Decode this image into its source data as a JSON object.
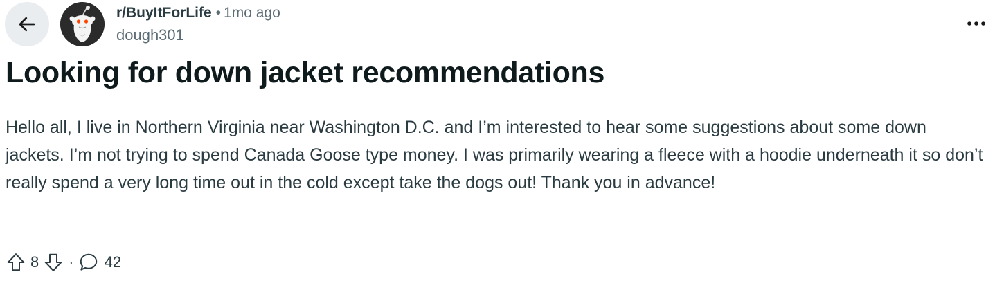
{
  "header": {
    "back_icon": "arrow-left-icon",
    "subreddit": "r/BuyItForLife",
    "separator": "•",
    "time_ago": "1mo ago",
    "username": "dough301",
    "more_icon": "more-horizontal-icon"
  },
  "post": {
    "title": "Looking for down jacket recommendations",
    "body": "Hello all, I live in Northern Virginia near Washington D.C. and I’m interested to hear some suggestions about some down jackets. I’m not trying to spend Canada Goose type money. I was primarily wearing a fleece with a hoodie underneath it so don’t really spend a very long time out in the cold except take the dogs out! Thank you in advance!"
  },
  "actions": {
    "upvote_icon": "arrow-up-icon",
    "score": "8",
    "downvote_icon": "arrow-down-icon",
    "separator": "·",
    "comment_icon": "comment-bubble-icon",
    "comment_count": "42"
  },
  "colors": {
    "back_button_bg": "#eaedef",
    "title_text": "#0f1a1c",
    "body_text": "#2a3c42",
    "meta_text": "#5c6c74"
  }
}
